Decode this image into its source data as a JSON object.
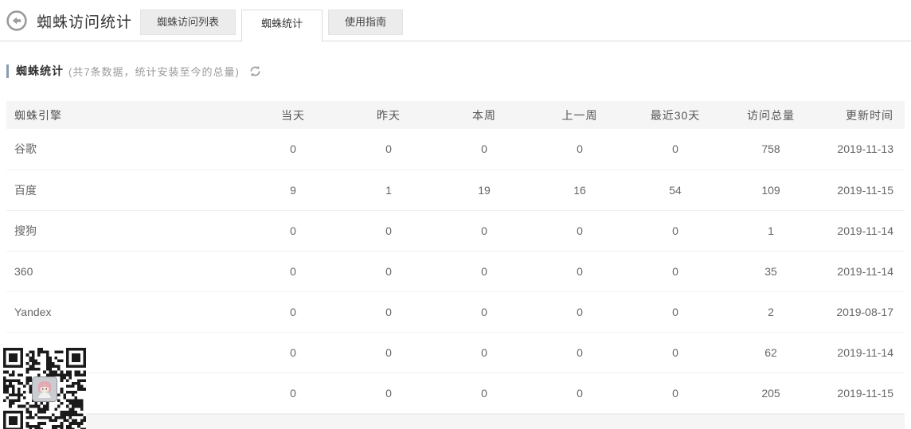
{
  "header": {
    "title": "蜘蛛访问统计",
    "back_icon": "arrow-left-circle",
    "tabs": [
      {
        "name": "tab-spider-visit-list",
        "label": "蜘蛛访问列表",
        "active": false
      },
      {
        "name": "tab-spider-stats",
        "label": "蜘蛛统计",
        "active": true
      },
      {
        "name": "tab-usage-guide",
        "label": "使用指南",
        "active": false
      }
    ]
  },
  "section": {
    "title": "蜘蛛统计",
    "subtitle": "(共7条数据，统计安装至今的总量)",
    "refresh_icon": "refresh"
  },
  "table": {
    "columns": [
      "蜘蛛引擎",
      "当天",
      "昨天",
      "本周",
      "上一周",
      "最近30天",
      "访问总量",
      "更新时间"
    ],
    "rows": [
      [
        "谷歌",
        "0",
        "0",
        "0",
        "0",
        "0",
        "758",
        "2019-11-13"
      ],
      [
        "百度",
        "9",
        "1",
        "19",
        "16",
        "54",
        "109",
        "2019-11-15"
      ],
      [
        "搜狗",
        "0",
        "0",
        "0",
        "0",
        "0",
        "1",
        "2019-11-14"
      ],
      [
        "360",
        "0",
        "0",
        "0",
        "0",
        "0",
        "35",
        "2019-11-14"
      ],
      [
        "Yandex",
        "0",
        "0",
        "0",
        "0",
        "0",
        "2",
        "2019-08-17"
      ],
      [
        "",
        "0",
        "0",
        "0",
        "0",
        "0",
        "62",
        "2019-11-14"
      ],
      [
        "",
        "0",
        "0",
        "0",
        "0",
        "0",
        "205",
        "2019-11-15"
      ]
    ]
  },
  "overlay": {
    "qr_icon": "qr-code-with-avatar"
  },
  "colors": {
    "accent": "#8a9cb2",
    "tab_bg": "#ececec",
    "table_header_bg": "#f5f5f5",
    "border": "#dcdcdc",
    "text_primary": "#333333",
    "text_secondary": "#666666",
    "text_muted": "#999999"
  }
}
